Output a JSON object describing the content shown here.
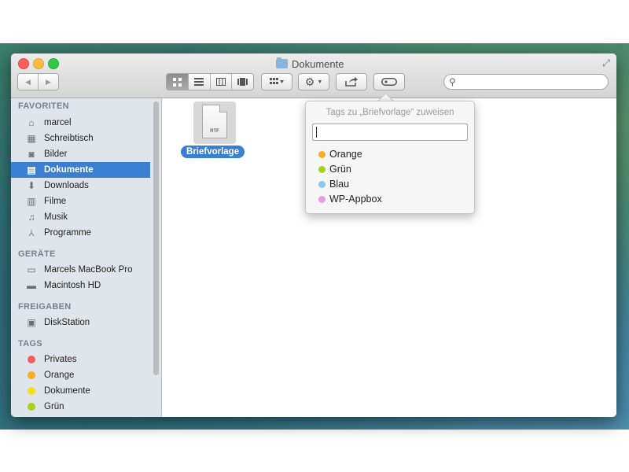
{
  "window": {
    "title": "Dokumente",
    "icons": {
      "folder": "folder-icon",
      "resize": "fullscreen-icon"
    }
  },
  "toolbar": {
    "back": "◀",
    "forward": "▶",
    "view_modes": [
      "icon-view-icon",
      "list-view-icon",
      "column-view-icon",
      "coverflow-view-icon"
    ],
    "arrange_icon": "arrange-icon",
    "action_icon": "gear-icon",
    "share_icon": "share-icon",
    "tags_icon": "tag-icon",
    "search_placeholder": ""
  },
  "sidebar": {
    "favorites_header": "FAVORITEN",
    "favorites": [
      {
        "label": "marcel",
        "icon": "home-icon"
      },
      {
        "label": "Schreibtisch",
        "icon": "desktop-icon"
      },
      {
        "label": "Bilder",
        "icon": "camera-icon"
      },
      {
        "label": "Dokumente",
        "icon": "documents-icon",
        "selected": true
      },
      {
        "label": "Downloads",
        "icon": "downloads-icon"
      },
      {
        "label": "Filme",
        "icon": "film-icon"
      },
      {
        "label": "Musik",
        "icon": "music-icon"
      },
      {
        "label": "Programme",
        "icon": "applications-icon"
      }
    ],
    "devices_header": "GERÄTE",
    "devices": [
      {
        "label": "Marcels MacBook Pro",
        "icon": "laptop-icon"
      },
      {
        "label": "Macintosh HD",
        "icon": "hard-drive-icon"
      }
    ],
    "shared_header": "FREIGABEN",
    "shared": [
      {
        "label": "DiskStation",
        "icon": "nas-icon"
      }
    ],
    "tags_header": "TAGS",
    "tags": [
      {
        "label": "Privates",
        "color": "#f2625c"
      },
      {
        "label": "Orange",
        "color": "#f7ad24"
      },
      {
        "label": "Dokumente",
        "color": "#f3df1a"
      },
      {
        "label": "Grün",
        "color": "#a5d41a"
      }
    ]
  },
  "content": {
    "file": {
      "name": "Briefvorlage",
      "ext": "RTF"
    }
  },
  "tag_popover": {
    "title": "Tags zu „Briefvorlage“ zuweisen",
    "input_value": "",
    "tags": [
      {
        "label": "Orange",
        "color": "#f7ad24"
      },
      {
        "label": "Grün",
        "color": "#a5d41a"
      },
      {
        "label": "Blau",
        "color": "#8ec5f2"
      },
      {
        "label": "WP-Appbox",
        "color": "#e89ae8"
      }
    ]
  }
}
